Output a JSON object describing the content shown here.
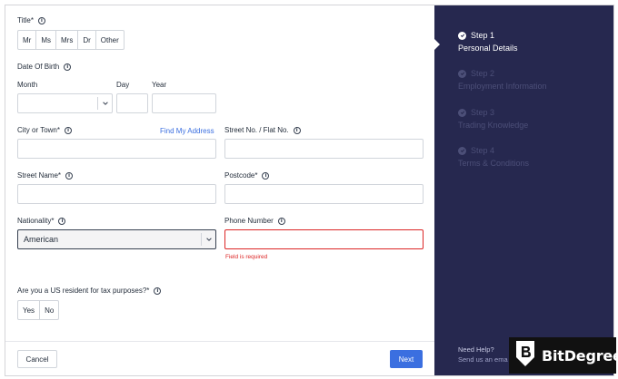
{
  "form": {
    "title_label": "Title*",
    "title_options": [
      "Mr",
      "Ms",
      "Mrs",
      "Dr",
      "Other"
    ],
    "dob_label": "Date Of Birth",
    "month_label": "Month",
    "day_label": "Day",
    "year_label": "Year",
    "city_label": "City or Town*",
    "find_address": "Find My Address",
    "street_no_label": "Street No. / Flat No.",
    "street_name_label": "Street Name*",
    "postcode_label": "Postcode*",
    "nationality_label": "Nationality*",
    "nationality_value": "American",
    "phone_label": "Phone Number",
    "phone_error": "Field is required",
    "us_resident_label": "Are you a US resident for tax purposes?*",
    "us_resident_options": [
      "Yes",
      "No"
    ]
  },
  "footer": {
    "cancel_label": "Cancel",
    "next_label": "Next"
  },
  "steps": [
    {
      "number": "Step 1",
      "name": "Personal Details",
      "state": "active"
    },
    {
      "number": "Step 2",
      "name": "Employment Information",
      "state": "inactive"
    },
    {
      "number": "Step 3",
      "name": "Trading Knowledge",
      "state": "inactive"
    },
    {
      "number": "Step 4",
      "name": "Terms & Conditions",
      "state": "inactive"
    }
  ],
  "help": {
    "title": "Need Help?",
    "text": "Send us an ema"
  },
  "watermark": {
    "brand": "BitDegree"
  },
  "colors": {
    "accent": "#3b6fe0",
    "sidebar": "#26284f",
    "error": "#dc2626"
  }
}
